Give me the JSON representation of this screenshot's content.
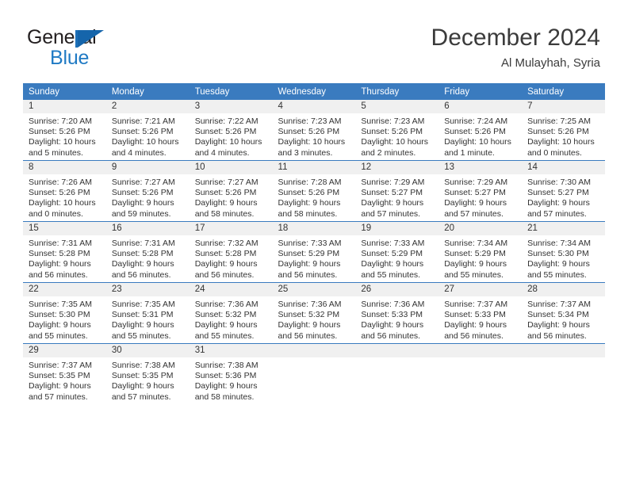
{
  "brand": {
    "name_part1": "General",
    "name_part2": "Blue",
    "flag_icon": "blue-flag-icon"
  },
  "header": {
    "title": "December 2024",
    "location": "Al Mulayhah, Syria"
  },
  "colors": {
    "header_blue": "#3a7bbf",
    "brand_blue": "#1f7ac4",
    "daynum_band": "#f0f0f0",
    "text": "#333333"
  },
  "weekday_headers": [
    "Sunday",
    "Monday",
    "Tuesday",
    "Wednesday",
    "Thursday",
    "Friday",
    "Saturday"
  ],
  "weeks": [
    [
      {
        "day": "1",
        "sunrise": "Sunrise: 7:20 AM",
        "sunset": "Sunset: 5:26 PM",
        "daylight1": "Daylight: 10 hours",
        "daylight2": "and 5 minutes."
      },
      {
        "day": "2",
        "sunrise": "Sunrise: 7:21 AM",
        "sunset": "Sunset: 5:26 PM",
        "daylight1": "Daylight: 10 hours",
        "daylight2": "and 4 minutes."
      },
      {
        "day": "3",
        "sunrise": "Sunrise: 7:22 AM",
        "sunset": "Sunset: 5:26 PM",
        "daylight1": "Daylight: 10 hours",
        "daylight2": "and 4 minutes."
      },
      {
        "day": "4",
        "sunrise": "Sunrise: 7:23 AM",
        "sunset": "Sunset: 5:26 PM",
        "daylight1": "Daylight: 10 hours",
        "daylight2": "and 3 minutes."
      },
      {
        "day": "5",
        "sunrise": "Sunrise: 7:23 AM",
        "sunset": "Sunset: 5:26 PM",
        "daylight1": "Daylight: 10 hours",
        "daylight2": "and 2 minutes."
      },
      {
        "day": "6",
        "sunrise": "Sunrise: 7:24 AM",
        "sunset": "Sunset: 5:26 PM",
        "daylight1": "Daylight: 10 hours",
        "daylight2": "and 1 minute."
      },
      {
        "day": "7",
        "sunrise": "Sunrise: 7:25 AM",
        "sunset": "Sunset: 5:26 PM",
        "daylight1": "Daylight: 10 hours",
        "daylight2": "and 0 minutes."
      }
    ],
    [
      {
        "day": "8",
        "sunrise": "Sunrise: 7:26 AM",
        "sunset": "Sunset: 5:26 PM",
        "daylight1": "Daylight: 10 hours",
        "daylight2": "and 0 minutes."
      },
      {
        "day": "9",
        "sunrise": "Sunrise: 7:27 AM",
        "sunset": "Sunset: 5:26 PM",
        "daylight1": "Daylight: 9 hours",
        "daylight2": "and 59 minutes."
      },
      {
        "day": "10",
        "sunrise": "Sunrise: 7:27 AM",
        "sunset": "Sunset: 5:26 PM",
        "daylight1": "Daylight: 9 hours",
        "daylight2": "and 58 minutes."
      },
      {
        "day": "11",
        "sunrise": "Sunrise: 7:28 AM",
        "sunset": "Sunset: 5:26 PM",
        "daylight1": "Daylight: 9 hours",
        "daylight2": "and 58 minutes."
      },
      {
        "day": "12",
        "sunrise": "Sunrise: 7:29 AM",
        "sunset": "Sunset: 5:27 PM",
        "daylight1": "Daylight: 9 hours",
        "daylight2": "and 57 minutes."
      },
      {
        "day": "13",
        "sunrise": "Sunrise: 7:29 AM",
        "sunset": "Sunset: 5:27 PM",
        "daylight1": "Daylight: 9 hours",
        "daylight2": "and 57 minutes."
      },
      {
        "day": "14",
        "sunrise": "Sunrise: 7:30 AM",
        "sunset": "Sunset: 5:27 PM",
        "daylight1": "Daylight: 9 hours",
        "daylight2": "and 57 minutes."
      }
    ],
    [
      {
        "day": "15",
        "sunrise": "Sunrise: 7:31 AM",
        "sunset": "Sunset: 5:28 PM",
        "daylight1": "Daylight: 9 hours",
        "daylight2": "and 56 minutes."
      },
      {
        "day": "16",
        "sunrise": "Sunrise: 7:31 AM",
        "sunset": "Sunset: 5:28 PM",
        "daylight1": "Daylight: 9 hours",
        "daylight2": "and 56 minutes."
      },
      {
        "day": "17",
        "sunrise": "Sunrise: 7:32 AM",
        "sunset": "Sunset: 5:28 PM",
        "daylight1": "Daylight: 9 hours",
        "daylight2": "and 56 minutes."
      },
      {
        "day": "18",
        "sunrise": "Sunrise: 7:33 AM",
        "sunset": "Sunset: 5:29 PM",
        "daylight1": "Daylight: 9 hours",
        "daylight2": "and 56 minutes."
      },
      {
        "day": "19",
        "sunrise": "Sunrise: 7:33 AM",
        "sunset": "Sunset: 5:29 PM",
        "daylight1": "Daylight: 9 hours",
        "daylight2": "and 55 minutes."
      },
      {
        "day": "20",
        "sunrise": "Sunrise: 7:34 AM",
        "sunset": "Sunset: 5:29 PM",
        "daylight1": "Daylight: 9 hours",
        "daylight2": "and 55 minutes."
      },
      {
        "day": "21",
        "sunrise": "Sunrise: 7:34 AM",
        "sunset": "Sunset: 5:30 PM",
        "daylight1": "Daylight: 9 hours",
        "daylight2": "and 55 minutes."
      }
    ],
    [
      {
        "day": "22",
        "sunrise": "Sunrise: 7:35 AM",
        "sunset": "Sunset: 5:30 PM",
        "daylight1": "Daylight: 9 hours",
        "daylight2": "and 55 minutes."
      },
      {
        "day": "23",
        "sunrise": "Sunrise: 7:35 AM",
        "sunset": "Sunset: 5:31 PM",
        "daylight1": "Daylight: 9 hours",
        "daylight2": "and 55 minutes."
      },
      {
        "day": "24",
        "sunrise": "Sunrise: 7:36 AM",
        "sunset": "Sunset: 5:32 PM",
        "daylight1": "Daylight: 9 hours",
        "daylight2": "and 55 minutes."
      },
      {
        "day": "25",
        "sunrise": "Sunrise: 7:36 AM",
        "sunset": "Sunset: 5:32 PM",
        "daylight1": "Daylight: 9 hours",
        "daylight2": "and 56 minutes."
      },
      {
        "day": "26",
        "sunrise": "Sunrise: 7:36 AM",
        "sunset": "Sunset: 5:33 PM",
        "daylight1": "Daylight: 9 hours",
        "daylight2": "and 56 minutes."
      },
      {
        "day": "27",
        "sunrise": "Sunrise: 7:37 AM",
        "sunset": "Sunset: 5:33 PM",
        "daylight1": "Daylight: 9 hours",
        "daylight2": "and 56 minutes."
      },
      {
        "day": "28",
        "sunrise": "Sunrise: 7:37 AM",
        "sunset": "Sunset: 5:34 PM",
        "daylight1": "Daylight: 9 hours",
        "daylight2": "and 56 minutes."
      }
    ],
    [
      {
        "day": "29",
        "sunrise": "Sunrise: 7:37 AM",
        "sunset": "Sunset: 5:35 PM",
        "daylight1": "Daylight: 9 hours",
        "daylight2": "and 57 minutes."
      },
      {
        "day": "30",
        "sunrise": "Sunrise: 7:38 AM",
        "sunset": "Sunset: 5:35 PM",
        "daylight1": "Daylight: 9 hours",
        "daylight2": "and 57 minutes."
      },
      {
        "day": "31",
        "sunrise": "Sunrise: 7:38 AM",
        "sunset": "Sunset: 5:36 PM",
        "daylight1": "Daylight: 9 hours",
        "daylight2": "and 58 minutes."
      },
      {
        "day": "",
        "sunrise": "",
        "sunset": "",
        "daylight1": "",
        "daylight2": ""
      },
      {
        "day": "",
        "sunrise": "",
        "sunset": "",
        "daylight1": "",
        "daylight2": ""
      },
      {
        "day": "",
        "sunrise": "",
        "sunset": "",
        "daylight1": "",
        "daylight2": ""
      },
      {
        "day": "",
        "sunrise": "",
        "sunset": "",
        "daylight1": "",
        "daylight2": ""
      }
    ]
  ]
}
